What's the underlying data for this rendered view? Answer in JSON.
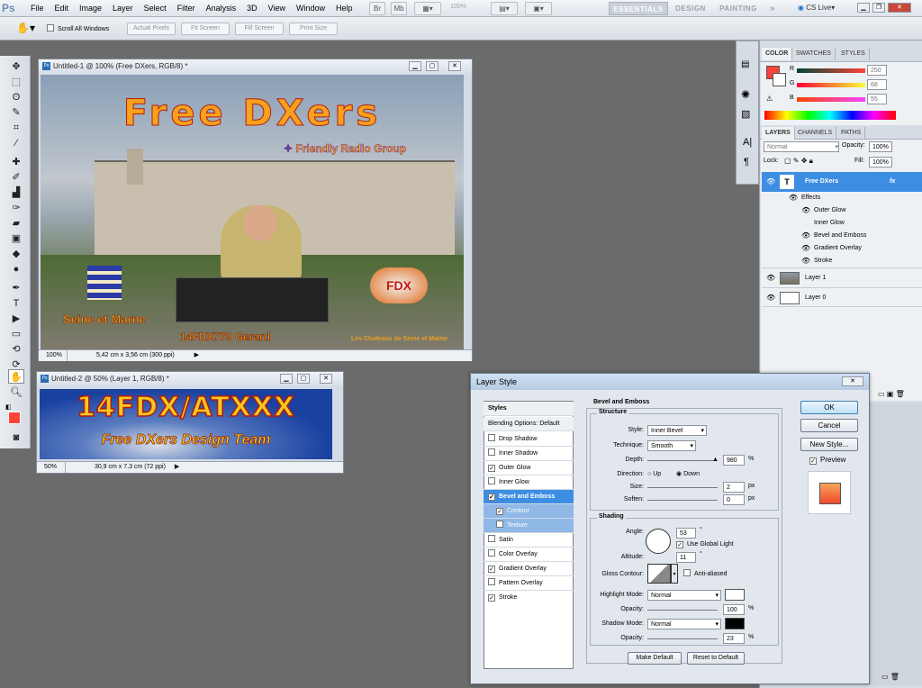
{
  "app": {
    "logo": "Ps",
    "menus": [
      "File",
      "Edit",
      "Image",
      "Layer",
      "Select",
      "Filter",
      "Analysis",
      "3D",
      "View",
      "Window",
      "Help"
    ],
    "zoom": "100%",
    "workspaces": [
      "ESSENTIALS",
      "DESIGN",
      "PAINTING"
    ],
    "more": "»",
    "cslive": "CS Live"
  },
  "options": {
    "scroll_all": "Scroll All Windows",
    "buttons": [
      "Actual Pixels",
      "Fit Screen",
      "Fill Screen",
      "Print Size"
    ]
  },
  "doc1": {
    "title": "Untitled-1 @ 100% (Free DXers, RGB/8) *",
    "zoom": "100%",
    "info": "5,42 cm x 3,56 cm (300 ppi)",
    "art_title": "Free DXers",
    "art_sub": "Friendly Radio Group",
    "art_left": "Seine et Marne",
    "art_callsign": "14FDX779 Gerard",
    "art_right": "Les Chateaux de Seine et Marne",
    "badge": "FDX"
  },
  "doc2": {
    "title": "Untitled-2 @ 50% (Layer 1, RGB/8) *",
    "zoom": "50%",
    "info": "30,9 cm x 7,3 cm (72 ppi)",
    "art_title": "14FDX/ATXXX",
    "art_sub": "Free DXers Design Team"
  },
  "color_panel": {
    "tabs": [
      "COLOR",
      "SWATCHES",
      "STYLES"
    ],
    "channels": [
      {
        "label": "R",
        "value": "250"
      },
      {
        "label": "G",
        "value": "68"
      },
      {
        "label": "B",
        "value": "55"
      }
    ],
    "fg": "#fa4437"
  },
  "layers_panel": {
    "tabs": [
      "LAYERS",
      "CHANNELS",
      "PATHS"
    ],
    "blend": "Normal",
    "opacity_label": "Opacity:",
    "opacity": "100%",
    "lock_label": "Lock:",
    "fill_label": "Fill:",
    "fill": "100%",
    "layers": [
      "Free DXers",
      "Effects",
      "Outer Glow",
      "Inner Glow",
      "Bevel and Emboss",
      "Gradient Overlay",
      "Stroke",
      "Layer 1",
      "Layer 0"
    ],
    "text_icon": "T",
    "fx": "fx"
  },
  "dialog": {
    "title": "Layer Style",
    "styles_header": "Styles",
    "blending": "Blending Options: Default",
    "effects": [
      {
        "label": "Drop Shadow",
        "checked": false
      },
      {
        "label": "Inner Shadow",
        "checked": false
      },
      {
        "label": "Outer Glow",
        "checked": true
      },
      {
        "label": "Inner Glow",
        "checked": false
      },
      {
        "label": "Bevel and Emboss",
        "checked": true
      },
      {
        "label": "Contour",
        "checked": true
      },
      {
        "label": "Texture",
        "checked": false
      },
      {
        "label": "Satin",
        "checked": false
      },
      {
        "label": "Color Overlay",
        "checked": false
      },
      {
        "label": "Gradient Overlay",
        "checked": true
      },
      {
        "label": "Pattern Overlay",
        "checked": false
      },
      {
        "label": "Stroke",
        "checked": true
      }
    ],
    "section": "Bevel and Emboss",
    "structure": "Structure",
    "style_label": "Style:",
    "style": "Inner Bevel",
    "technique_label": "Technique:",
    "technique": "Smooth",
    "depth_label": "Depth:",
    "depth": "980",
    "pct": "%",
    "direction_label": "Direction:",
    "up": "Up",
    "down": "Down",
    "size_label": "Size:",
    "size": "2",
    "px": "px",
    "soften_label": "Soften:",
    "soften": "0",
    "shading": "Shading",
    "angle_label": "Angle:",
    "angle": "53",
    "deg": "°",
    "global_light": "Use Global Light",
    "altitude_label": "Altitude:",
    "altitude": "11",
    "gloss_label": "Gloss Contour:",
    "anti_aliased": "Anti-aliased",
    "highlight_label": "Highlight Mode:",
    "highlight": "Normal",
    "hl_opacity": "100",
    "opacity_label": "Opacity:",
    "shadow_label": "Shadow Mode:",
    "shadow": "Normal",
    "sh_opacity": "23",
    "make_default": "Make Default",
    "reset_default": "Reset to Default",
    "ok": "OK",
    "cancel": "Cancel",
    "new_style": "New Style...",
    "preview": "Preview"
  }
}
